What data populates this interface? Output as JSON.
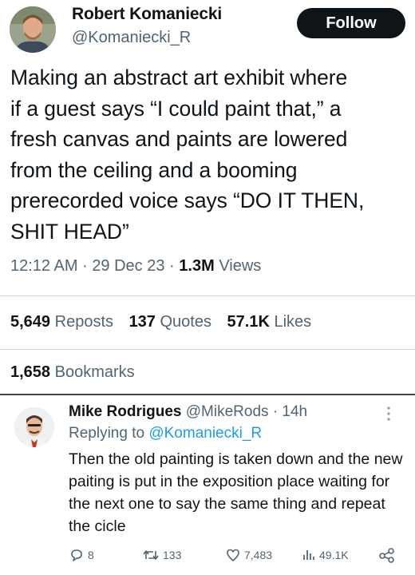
{
  "tweet": {
    "author_name": "Robert Komaniecki",
    "author_handle": "@Komaniecki_R",
    "follow_label": "Follow",
    "text": "Making an abstract art exhibit where\nif a guest says “I could paint that,” a\nfresh canvas and paints are lowered\nfrom the ceiling and a booming\nprerecorded voice says “DO IT THEN,\nSHIT HEAD”",
    "time": "12:12 AM",
    "date": "29 Dec 23",
    "views_count": "1.3M",
    "views_label": "Views",
    "reposts_count": "5,649",
    "reposts_label": "Reposts",
    "quotes_count": "137",
    "quotes_label": "Quotes",
    "likes_count": "57.1K",
    "likes_label": "Likes",
    "bookmarks_count": "1,658",
    "bookmarks_label": "Bookmarks",
    "separator": "·"
  },
  "reply": {
    "author_name": "Mike Rodrigues",
    "author_handle": "@MikeRods",
    "time": "14h",
    "replying_prefix": "Replying to",
    "replying_to": "@Komaniecki_R",
    "text": "Then the old painting is taken down and the new paiting is put in the exposition place waiting for the next one to say the same thing and repeat the cicle",
    "actions": {
      "replies": "8",
      "reposts": "133",
      "likes": "7,483",
      "views": "49.1K"
    }
  },
  "icons": {
    "reply": "speech-bubble-icon",
    "repost": "repost-arrows-icon",
    "like": "heart-icon",
    "views": "bar-chart-icon",
    "share": "share-nodes-icon",
    "more": "vertical-dots-icon"
  },
  "colors": {
    "text": "#0f1419",
    "secondary": "#536471",
    "link": "#1d9bf0",
    "button": "#0f1419"
  }
}
